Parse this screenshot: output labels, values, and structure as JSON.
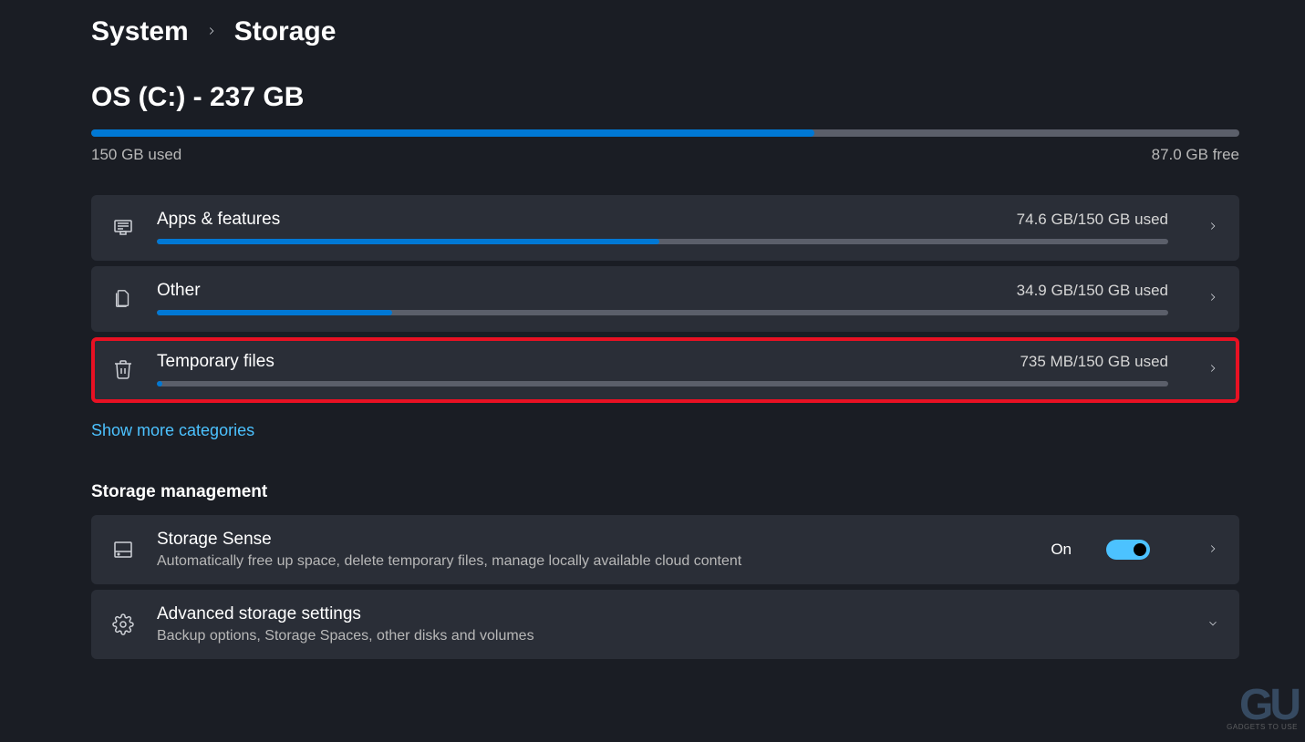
{
  "breadcrumb": {
    "parent": "System",
    "current": "Storage"
  },
  "drive": {
    "title": "OS (C:) - 237 GB",
    "used_label": "150 GB used",
    "free_label": "87.0 GB free",
    "fill_percent": 63
  },
  "categories": [
    {
      "icon": "apps",
      "label": "Apps & features",
      "usage": "74.6 GB/150 GB used",
      "fill_percent": 49.7,
      "highlight": false
    },
    {
      "icon": "files",
      "label": "Other",
      "usage": "34.9 GB/150 GB used",
      "fill_percent": 23.3,
      "highlight": false
    },
    {
      "icon": "trash",
      "label": "Temporary files",
      "usage": "735 MB/150 GB used",
      "fill_percent": 0.5,
      "highlight": true
    }
  ],
  "show_more": "Show more categories",
  "management": {
    "heading": "Storage management",
    "items": [
      {
        "icon": "disk",
        "title": "Storage Sense",
        "desc": "Automatically free up space, delete temporary files, manage locally available cloud content",
        "toggle_label": "On",
        "has_toggle": true,
        "chevron": "right"
      },
      {
        "icon": "gear",
        "title": "Advanced storage settings",
        "desc": "Backup options, Storage Spaces, other disks and volumes",
        "has_toggle": false,
        "chevron": "down"
      }
    ]
  },
  "watermark": {
    "logo": "GU",
    "tag": "GADGETS TO USE"
  }
}
